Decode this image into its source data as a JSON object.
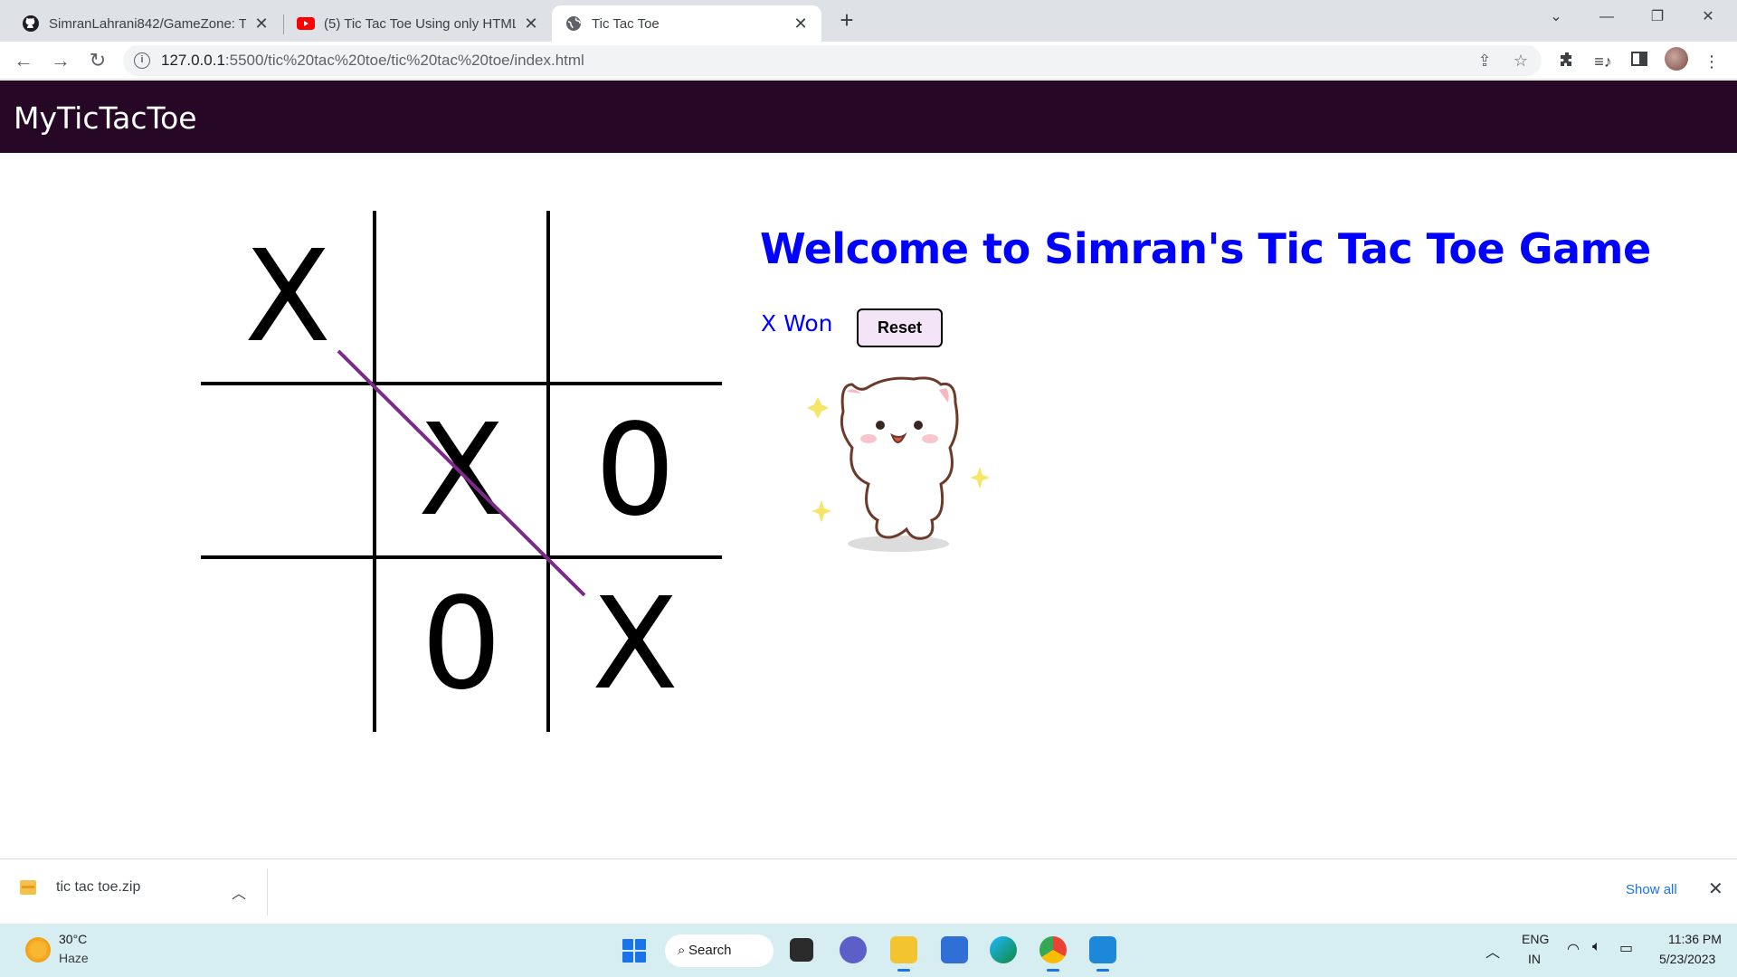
{
  "browser": {
    "tabs": [
      {
        "title": "SimranLahrani842/GameZone: Th",
        "icon": "github-icon"
      },
      {
        "title": "(5) Tic Tac Toe Using only HTML, (",
        "icon": "youtube-icon"
      },
      {
        "title": "Tic Tac Toe",
        "icon": "globe-icon",
        "active": true
      }
    ],
    "url_host": "127.0.0.1",
    "url_rest": ":5500/tic%20tac%20toe/tic%20tac%20toe/index.html"
  },
  "page": {
    "brand": "MyTicTacToe",
    "heading": "Welcome to Simran's Tic Tac Toe Game",
    "status": "X Won",
    "reset_label": "Reset",
    "board": [
      "X",
      "",
      "",
      "",
      "X",
      "0",
      "",
      "0",
      "X"
    ],
    "win_color": "#7b2a8a",
    "accent_color": "#0000ff",
    "navbar_color": "#260826"
  },
  "downloads": {
    "file": "tic tac toe.zip",
    "show_all": "Show all"
  },
  "taskbar": {
    "temperature": "30°C",
    "weather": "Haze",
    "search": "Search",
    "lang": "ENG",
    "region": "IN",
    "time": "11:36 PM",
    "date": "5/23/2023"
  }
}
